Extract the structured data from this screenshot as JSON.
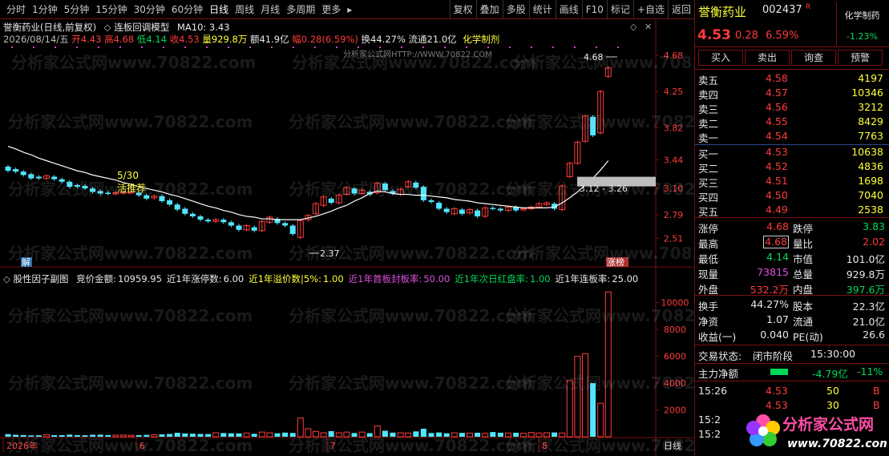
{
  "toolbar": {
    "periods": [
      "分时",
      "1分钟",
      "5分钟",
      "15分钟",
      "30分钟",
      "60分钟",
      "日线",
      "周线",
      "月线",
      "多周期",
      "更多"
    ],
    "active": "日线",
    "more_arrow": "▸",
    "right_buttons": [
      "复权",
      "叠加",
      "多股",
      "统计",
      "画线",
      "F10",
      "标记",
      "+自选",
      "返回"
    ]
  },
  "main_chart": {
    "title": "誉衡药业(日线,前复权)",
    "indicator": "连板回调模型",
    "ma10": "MA10: 3.43",
    "date_line": {
      "date": "2026/08/14/五",
      "open_label": "开",
      "open": "4.43",
      "high_label": "高",
      "high": "4.68",
      "low_label": "低",
      "low": "4.14",
      "close_label": "收",
      "close": "4.53",
      "volume_label": "量",
      "volume": "929.8万",
      "amount_label": "额",
      "amount": "41.9亿",
      "change_label": "幅",
      "change": "0.28(6.59%)",
      "turnover_label": "换",
      "turnover": "44.27%",
      "float_label": "流通",
      "float": "21.0亿",
      "sector": "化学制剂"
    },
    "watermark_top": "分析家公式网HTTP://WWW.70822.COM",
    "annotation_date": "5/30",
    "annotation_text": "活推荐",
    "label_high": "4.68",
    "label_low": "2.37",
    "label_range": "3.12 - 3.26",
    "marker_jie": "解",
    "marker_zt": "涨榜",
    "y_ticks": [
      "4.68",
      "4.25",
      "3.82",
      "3.44",
      "3.10",
      "2.79",
      "2.51"
    ]
  },
  "sub_chart": {
    "title": "股性因子副图",
    "fields": [
      {
        "label": "竞价金额:",
        "value": "10959.95",
        "color": "white"
      },
      {
        "label": "近1年涨停数:",
        "value": "6.00",
        "color": "white"
      },
      {
        "label": "近1年溢价数|5%:",
        "value": "1.00",
        "color": "yellow"
      },
      {
        "label": "近1年首板封板率:",
        "value": "50.00",
        "color": "purple"
      },
      {
        "label": "近1年次日红盘率:",
        "value": "1.00",
        "color": "green"
      },
      {
        "label": "近1年连板率:",
        "value": "25.00",
        "color": "white"
      }
    ],
    "y_ticks": [
      "10000",
      "8000",
      "6000",
      "4000",
      "2000"
    ]
  },
  "x_axis": {
    "labels": [
      "2026年",
      "6",
      "7",
      "8"
    ],
    "period": "日线"
  },
  "watermark_text": "分析家公式网www.70822.com",
  "chart_data": {
    "type": "candlestick",
    "candles": [
      {
        "o": 3.36,
        "c": 3.31
      },
      {
        "o": 3.33,
        "c": 3.3
      },
      {
        "o": 3.3,
        "c": 3.26
      },
      {
        "o": 3.27,
        "c": 3.22
      },
      {
        "o": 3.24,
        "c": 3.22
      },
      {
        "o": 3.22,
        "c": 3.25
      },
      {
        "o": 3.24,
        "c": 3.21
      },
      {
        "o": 3.21,
        "c": 3.18
      },
      {
        "o": 3.18,
        "c": 3.12
      },
      {
        "o": 3.14,
        "c": 3.12
      },
      {
        "o": 3.13,
        "c": 3.1
      },
      {
        "o": 3.1,
        "c": 3.06
      },
      {
        "o": 3.07,
        "c": 3.04
      },
      {
        "o": 3.05,
        "c": 3.04
      },
      {
        "o": 3.04,
        "c": 3.05
      },
      {
        "o": 3.05,
        "c": 3.06
      },
      {
        "o": 3.06,
        "c": 3.06
      },
      {
        "o": 3.05,
        "c": 3.02
      },
      {
        "o": 3.02,
        "c": 2.98
      },
      {
        "o": 2.99,
        "c": 3.01
      },
      {
        "o": 3.01,
        "c": 2.95
      },
      {
        "o": 2.96,
        "c": 2.91
      },
      {
        "o": 2.91,
        "c": 2.85
      },
      {
        "o": 2.86,
        "c": 2.8
      },
      {
        "o": 2.8,
        "c": 2.77
      },
      {
        "o": 2.77,
        "c": 2.73
      },
      {
        "o": 2.73,
        "c": 2.71
      },
      {
        "o": 2.71,
        "c": 2.73
      },
      {
        "o": 2.73,
        "c": 2.7
      },
      {
        "o": 2.7,
        "c": 2.66
      },
      {
        "o": 2.66,
        "c": 2.61
      },
      {
        "o": 2.61,
        "c": 2.66
      },
      {
        "o": 2.64,
        "c": 2.6
      },
      {
        "o": 2.6,
        "c": 2.71
      },
      {
        "o": 2.7,
        "c": 2.76
      },
      {
        "o": 2.74,
        "c": 2.69
      },
      {
        "o": 2.69,
        "c": 2.66
      },
      {
        "o": 2.66,
        "c": 2.56
      },
      {
        "o": 2.52,
        "c": 2.72
      },
      {
        "o": 2.73,
        "c": 2.78
      },
      {
        "o": 2.8,
        "c": 2.92
      },
      {
        "o": 2.9,
        "c": 3.0
      },
      {
        "o": 2.98,
        "c": 2.93
      },
      {
        "o": 2.93,
        "c": 3.02
      },
      {
        "o": 3.03,
        "c": 3.11
      },
      {
        "o": 3.1,
        "c": 3.04
      },
      {
        "o": 3.04,
        "c": 3.08
      },
      {
        "o": 3.06,
        "c": 3.03
      },
      {
        "o": 3.05,
        "c": 3.16
      },
      {
        "o": 3.16,
        "c": 3.08
      },
      {
        "o": 3.07,
        "c": 3.04
      },
      {
        "o": 3.03,
        "c": 3.09
      },
      {
        "o": 3.12,
        "c": 3.18
      },
      {
        "o": 3.17,
        "c": 3.11
      },
      {
        "o": 3.12,
        "c": 2.96
      },
      {
        "o": 2.96,
        "c": 2.94
      },
      {
        "o": 2.93,
        "c": 2.86
      },
      {
        "o": 2.86,
        "c": 2.82
      },
      {
        "o": 2.8,
        "c": 2.86
      },
      {
        "o": 2.85,
        "c": 2.8
      },
      {
        "o": 2.81,
        "c": 2.85
      },
      {
        "o": 2.84,
        "c": 2.77
      },
      {
        "o": 2.77,
        "c": 2.87
      },
      {
        "o": 2.87,
        "c": 2.86
      },
      {
        "o": 2.86,
        "c": 2.84
      },
      {
        "o": 2.84,
        "c": 2.88
      },
      {
        "o": 2.88,
        "c": 2.84
      },
      {
        "o": 2.85,
        "c": 2.86
      },
      {
        "o": 2.86,
        "c": 2.88
      },
      {
        "o": 2.88,
        "c": 2.92
      },
      {
        "o": 2.91,
        "c": 2.93
      },
      {
        "o": 2.92,
        "c": 2.86
      },
      {
        "o": 2.85,
        "c": 3.13
      },
      {
        "o": 3.24,
        "c": 3.4
      },
      {
        "o": 3.4,
        "c": 3.65
      },
      {
        "o": 3.66,
        "c": 3.96
      },
      {
        "o": 3.95,
        "c": 3.73
      },
      {
        "o": 3.76,
        "c": 4.25
      },
      {
        "o": 4.43,
        "c": 4.53
      }
    ],
    "ma10": [
      3.6,
      3.57,
      3.53,
      3.5,
      3.46,
      3.43,
      3.4,
      3.37,
      3.34,
      3.31,
      3.29,
      3.26,
      3.24,
      3.22,
      3.2,
      3.17,
      3.15,
      3.12,
      3.1,
      3.08,
      3.06,
      3.03,
      3.01,
      2.98,
      2.95,
      2.92,
      2.89,
      2.87,
      2.84,
      2.82,
      2.79,
      2.77,
      2.76,
      2.74,
      2.74,
      2.73,
      2.73,
      2.73,
      2.73,
      2.75,
      2.77,
      2.8,
      2.83,
      2.87,
      2.9,
      2.95,
      2.99,
      3.04,
      3.07,
      3.06,
      3.04,
      3.03,
      3.03,
      3.02,
      3.02,
      3.01,
      3.0,
      2.99,
      2.97,
      2.96,
      2.95,
      2.93,
      2.92,
      2.91,
      2.9,
      2.89,
      2.88,
      2.87,
      2.87,
      2.87,
      2.87,
      2.88,
      2.93,
      2.99,
      3.06,
      3.14,
      3.22,
      3.32,
      3.43
    ],
    "subchart_values": [
      200,
      150,
      130,
      100,
      110,
      150,
      120,
      120,
      160,
      120,
      110,
      150,
      160,
      130,
      120,
      130,
      110,
      120,
      140,
      150,
      180,
      210,
      300,
      250,
      230,
      210,
      200,
      300,
      280,
      260,
      250,
      280,
      220,
      350,
      300,
      260,
      310,
      280,
      1400,
      600,
      400,
      300,
      420,
      300,
      350,
      280,
      350,
      270,
      800,
      450,
      310,
      300,
      280,
      400,
      600,
      280,
      320,
      260,
      300,
      290,
      270,
      300,
      260,
      350,
      300,
      280,
      300,
      260,
      320,
      280,
      300,
      320,
      280,
      4200,
      6000,
      6200,
      4000,
      2500,
      10800
    ],
    "ylim": [
      2.37,
      4.68
    ],
    "sub_ylim": [
      0,
      11000
    ]
  },
  "right_panel": {
    "name": "誉衡药业",
    "code": "002437",
    "r_mark": "R",
    "sector": "化学制药",
    "sector_change": "-1.23%",
    "price": "4.53",
    "change": "0.28",
    "change_pct": "6.59%",
    "buttons": [
      "买入",
      "卖出",
      "询查",
      "预警"
    ],
    "sells": [
      {
        "label": "卖五",
        "price": "4.58",
        "vol": "4197"
      },
      {
        "label": "卖四",
        "price": "4.57",
        "vol": "10346"
      },
      {
        "label": "卖三",
        "price": "4.56",
        "vol": "3212"
      },
      {
        "label": "卖二",
        "price": "4.55",
        "vol": "8429"
      },
      {
        "label": "卖一",
        "price": "4.54",
        "vol": "7763"
      }
    ],
    "buys": [
      {
        "label": "买一",
        "price": "4.53",
        "vol": "10638"
      },
      {
        "label": "买二",
        "price": "4.52",
        "vol": "4836"
      },
      {
        "label": "买三",
        "price": "4.51",
        "vol": "1698"
      },
      {
        "label": "买四",
        "price": "4.50",
        "vol": "7040"
      },
      {
        "label": "买五",
        "price": "4.49",
        "vol": "2538"
      }
    ],
    "stats1": [
      {
        "l1": "涨停",
        "v1": "4.68",
        "c1": "red",
        "l2": "跌停",
        "v2": "3.83",
        "c2": "green"
      },
      {
        "l1": "最高",
        "v1": "4.68",
        "c1": "red",
        "l2": "量比",
        "v2": "2.02",
        "c2": "red"
      },
      {
        "l1": "最低",
        "v1": "4.14",
        "c1": "green",
        "l2": "市值",
        "v2": "101.0亿",
        "c2": "white"
      },
      {
        "l1": "现量",
        "v1": "73815",
        "c1": "purple",
        "l2": "总量",
        "v2": "929.8万",
        "c2": "white"
      },
      {
        "l1": "外盘",
        "v1": "532.2万",
        "c1": "red",
        "l2": "内盘",
        "v2": "397.6万",
        "c2": "green"
      }
    ],
    "stats2": [
      {
        "l1": "换手",
        "v1": "44.27%",
        "c1": "white",
        "l2": "股本",
        "v2": "22.3亿",
        "c2": "white"
      },
      {
        "l1": "净资",
        "v1": "1.07",
        "c1": "white",
        "l2": "流通",
        "v2": "21.0亿",
        "c2": "white"
      },
      {
        "l1": "收益(一)",
        "v1": "0.040",
        "c1": "white",
        "l2": "PE(动)",
        "v2": "26.6",
        "c2": "white"
      }
    ],
    "trade_status_label": "交易状态:",
    "trade_status": "闭市阶段",
    "trade_time": "15:30:00",
    "main_flow_label": "主力净额",
    "main_flow": "-4.79亿",
    "main_flow_pct": "-11%",
    "ticks": [
      {
        "time": "15:26",
        "price": "4.53",
        "vol": "50",
        "dir": "B"
      },
      {
        "time": "",
        "price": "4.53",
        "vol": "30",
        "dir": "B"
      },
      {
        "time": "15:2",
        "price": "",
        "vol": "",
        "dir": ""
      },
      {
        "time": "15:2",
        "price": "",
        "vol": "",
        "dir": ""
      }
    ]
  },
  "logo": {
    "text": "分析家公式网",
    "url": "www.70822.com"
  }
}
